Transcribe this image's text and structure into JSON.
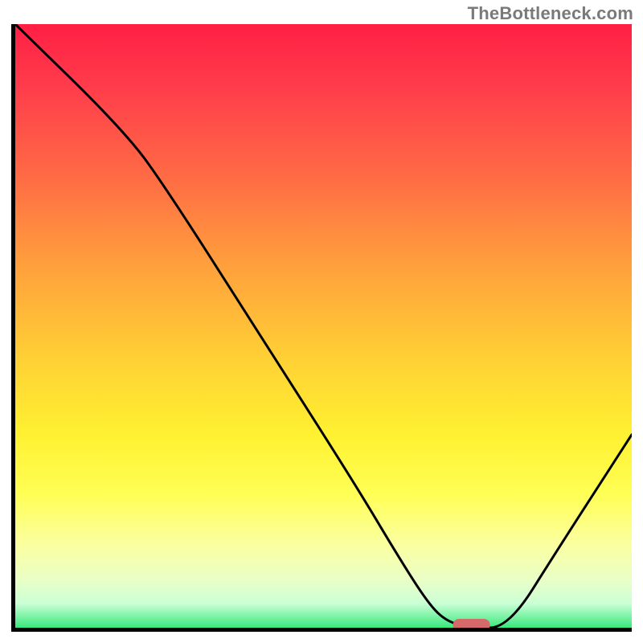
{
  "watermark": "TheBottleneck.com",
  "colors": {
    "axis": "#000000",
    "curve": "#000000",
    "marker": "#d66a6a",
    "gradient_top": "#ff1f44",
    "gradient_bottom": "#39e87d"
  },
  "chart_data": {
    "type": "line",
    "title": "",
    "xlabel": "",
    "ylabel": "",
    "xlim": [
      0,
      100
    ],
    "ylim": [
      0,
      100
    ],
    "grid": false,
    "legend": false,
    "x": [
      0,
      18,
      25,
      40,
      55,
      62,
      67,
      70,
      74,
      80,
      88,
      100
    ],
    "values": [
      100,
      82,
      72,
      48,
      24,
      12,
      4,
      1,
      0,
      0,
      13,
      32
    ],
    "marker": {
      "x": 74,
      "y": 0,
      "width": 6,
      "height": 2,
      "shape": "rounded-rect"
    },
    "annotations": []
  }
}
